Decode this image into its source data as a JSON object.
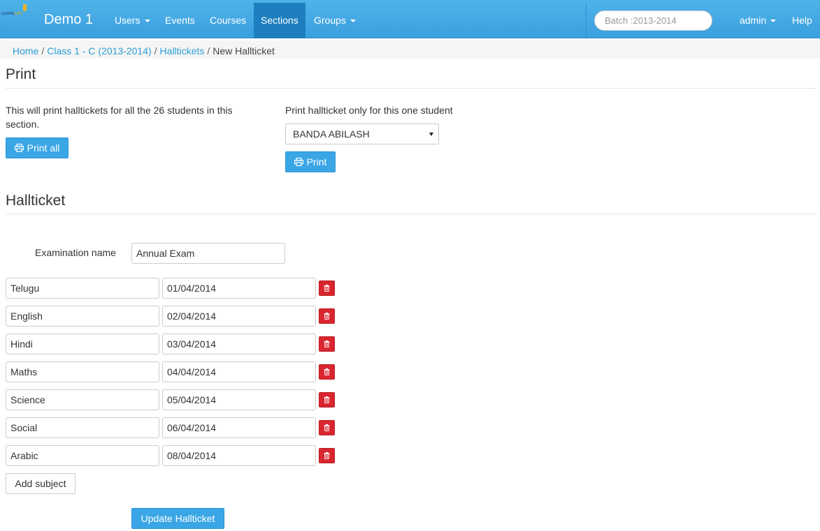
{
  "navbar": {
    "logo_text_main": "cosmic",
    "logo_text_alt": "vent",
    "brand": "Demo 1",
    "items": [
      {
        "label": "Users",
        "dropdown": true
      },
      {
        "label": "Events",
        "dropdown": false
      },
      {
        "label": "Courses",
        "dropdown": false
      },
      {
        "label": "Sections",
        "dropdown": false,
        "active": true
      },
      {
        "label": "Groups",
        "dropdown": true
      }
    ],
    "batch_placeholder": "Batch :2013-2014",
    "user_menu": "admin",
    "help": "Help",
    "colors": {
      "bar": "#3ea7e4",
      "active": "#1d7fc0"
    }
  },
  "breadcrumb": {
    "home": "Home",
    "section": "Class 1 - C (2013-2014)",
    "halltickets": "Halltickets",
    "current": "New Hallticket",
    "separator": "/"
  },
  "print_section": {
    "heading": "Print",
    "all_description": "This will print halltickets for all the 26 students in this section.",
    "print_all_label": "Print all",
    "one_description": "Print hallticket only for this one student",
    "selected_student": "BANDA ABILASH",
    "print_label": "Print",
    "icon": "print-icon"
  },
  "hallticket": {
    "heading": "Hallticket",
    "exam_label": "Examination name",
    "exam_name": "Annual Exam",
    "subjects": [
      {
        "name": "Telugu",
        "date": "01/04/2014"
      },
      {
        "name": "English",
        "date": "02/04/2014"
      },
      {
        "name": "Hindi",
        "date": "03/04/2014"
      },
      {
        "name": "Maths",
        "date": "04/04/2014"
      },
      {
        "name": "Science",
        "date": "05/04/2014"
      },
      {
        "name": "Social",
        "date": "06/04/2014"
      },
      {
        "name": "Arabic",
        "date": "08/04/2014"
      }
    ],
    "delete_icon": "trash-icon",
    "add_subject_label": "Add subject",
    "update_label": "Update Hallticket"
  }
}
